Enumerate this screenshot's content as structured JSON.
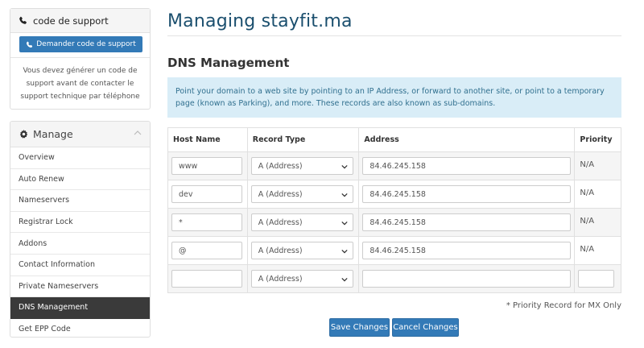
{
  "support": {
    "title": "code de support",
    "button_label": "Demander code de support",
    "description": "Vous devez générer un code de support avant de contacter le support technique par téléphone"
  },
  "manage": {
    "title": "Manage",
    "items": [
      {
        "label": "Overview"
      },
      {
        "label": "Auto Renew"
      },
      {
        "label": "Nameservers"
      },
      {
        "label": "Registrar Lock"
      },
      {
        "label": "Addons"
      },
      {
        "label": "Contact Information"
      },
      {
        "label": "Private Nameservers"
      },
      {
        "label": "DNS Management",
        "active": true
      },
      {
        "label": "Get EPP Code"
      }
    ]
  },
  "main": {
    "page_title": "Managing stayfit.ma",
    "section_title": "DNS Management",
    "info_text": "Point your domain to a web site by pointing to an IP Address, or forward to another site, or point to a temporary page (known as Parking), and more. These records are also known as sub-domains.",
    "table": {
      "headers": [
        "Host Name",
        "Record Type",
        "Address",
        "Priority"
      ],
      "rows": [
        {
          "host": "www",
          "type": "A (Address)",
          "address": "84.46.245.158",
          "priority": "N/A"
        },
        {
          "host": "dev",
          "type": "A (Address)",
          "address": "84.46.245.158",
          "priority": "N/A"
        },
        {
          "host": "*",
          "type": "A (Address)",
          "address": "84.46.245.158",
          "priority": "N/A"
        },
        {
          "host": "@",
          "type": "A (Address)",
          "address": "84.46.245.158",
          "priority": "N/A"
        },
        {
          "host": "",
          "type": "A (Address)",
          "address": "",
          "priority": ""
        }
      ]
    },
    "mx_note": "* Priority Record for MX Only",
    "save_label": "Save Changes",
    "cancel_label": "Cancel Changes"
  },
  "colors": {
    "primary": "#337ab7",
    "title": "#1b4f6e",
    "info_bg": "#d9edf7",
    "info_text": "#31708f",
    "active_item": "#3a3a3a"
  }
}
